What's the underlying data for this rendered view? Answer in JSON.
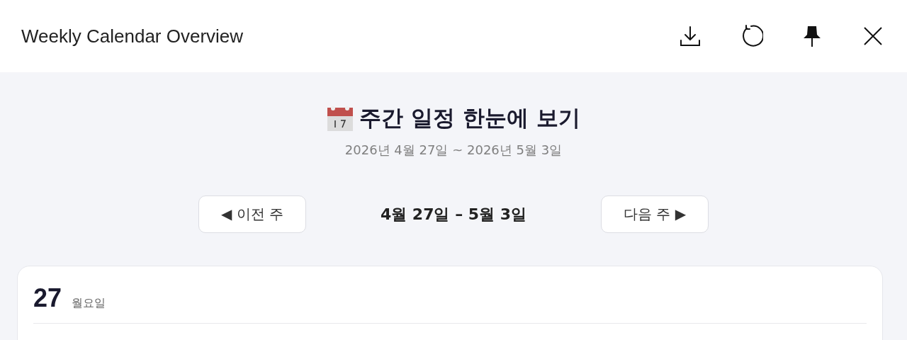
{
  "window": {
    "title": "Weekly Calendar Overview"
  },
  "toolbar": [
    {
      "kind": "download"
    },
    {
      "kind": "refresh"
    },
    {
      "kind": "pin"
    },
    {
      "kind": "close"
    }
  ],
  "heading": {
    "title": "주간 일정 한눈에 보기",
    "range": "2026년 4월 27일 ~ 2026년 5월 3일"
  },
  "nav": {
    "prev": "◀ 이전 주",
    "label": "4월 27일 – 5월 3일",
    "next": "다음 주 ▶"
  },
  "days": [
    {
      "date": "27",
      "weekday": "월요일"
    }
  ]
}
